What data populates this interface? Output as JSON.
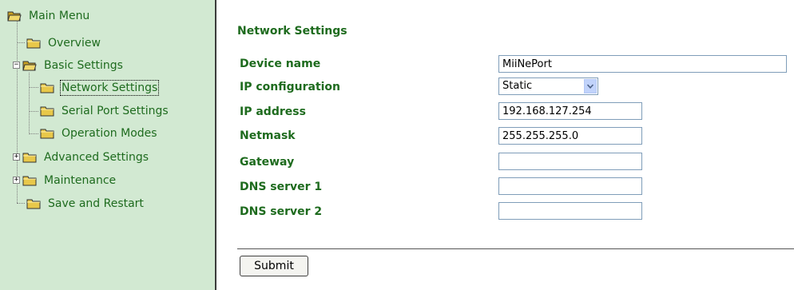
{
  "nav": {
    "items": [
      {
        "label": "Main Menu"
      },
      {
        "label": "Overview"
      },
      {
        "label": "Basic Settings"
      },
      {
        "label": "Network Settings"
      },
      {
        "label": "Serial Port Settings"
      },
      {
        "label": "Operation Modes"
      },
      {
        "label": "Advanced Settings"
      },
      {
        "label": "Maintenance"
      },
      {
        "label": "Save and Restart"
      }
    ],
    "selected": "Network Settings"
  },
  "main": {
    "title": "Network Settings",
    "fields": [
      {
        "label": "Device name",
        "value": "MiiNePort"
      },
      {
        "label": "IP configuration",
        "value": "Static"
      },
      {
        "label": "IP address",
        "value": "192.168.127.254"
      },
      {
        "label": "Netmask",
        "value": "255.255.255.0"
      },
      {
        "label": "Gateway",
        "value": ""
      },
      {
        "label": "DNS server 1",
        "value": ""
      },
      {
        "label": "DNS server 2",
        "value": ""
      }
    ],
    "submit_label": "Submit"
  },
  "colors": {
    "nav_background": "#d2e9d2",
    "text_green": "#1e6b1e",
    "folder_yellow": "#e8c84a"
  }
}
